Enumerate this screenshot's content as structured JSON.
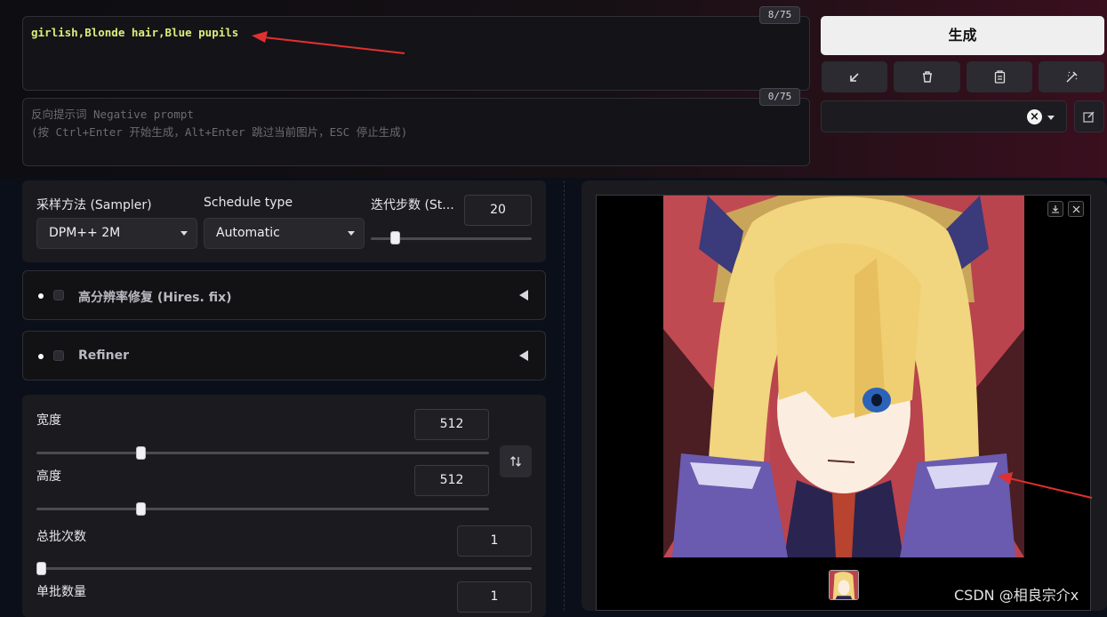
{
  "prompt": {
    "value": "girlish,Blonde hair,Blue pupils",
    "counter": "8/75"
  },
  "negative_prompt": {
    "placeholder_line1": "反向提示词 Negative prompt",
    "placeholder_line2": "(按 Ctrl+Enter 开始生成，Alt+Enter 跳过当前图片，ESC 停止生成)",
    "counter": "0/75"
  },
  "sampling": {
    "sampler_label": "采样方法 (Sampler)",
    "sampler_value": "DPM++ 2M",
    "schedule_label": "Schedule type",
    "schedule_value": "Automatic",
    "steps_label": "迭代步数 (St...",
    "steps_value": "20",
    "steps_fraction": 0.19
  },
  "accordions": {
    "hires_label": "高分辨率修复 (Hires. fix)",
    "refiner_label": "Refiner"
  },
  "dimensions": {
    "width_label": "宽度",
    "width_value": "512",
    "height_label": "高度",
    "height_value": "512",
    "batch_count_label": "总批次数",
    "batch_count_value": "1",
    "batch_size_label": "单批数量",
    "batch_size_value": "1"
  },
  "actions": {
    "generate_label": "生成"
  },
  "icons": [
    "arrow-down-left-icon",
    "trash-icon",
    "clipboard-icon",
    "magic-wand-icon",
    "clear-icon",
    "chevron-down-icon",
    "edit-icon",
    "download-icon",
    "close-icon",
    "swap-icon"
  ],
  "colors": {
    "prompt_text": "#d9f07a",
    "generate_bg": "#efefef",
    "annotation_arrow": "#e03030"
  },
  "watermark": "CSDN @相良宗介x"
}
